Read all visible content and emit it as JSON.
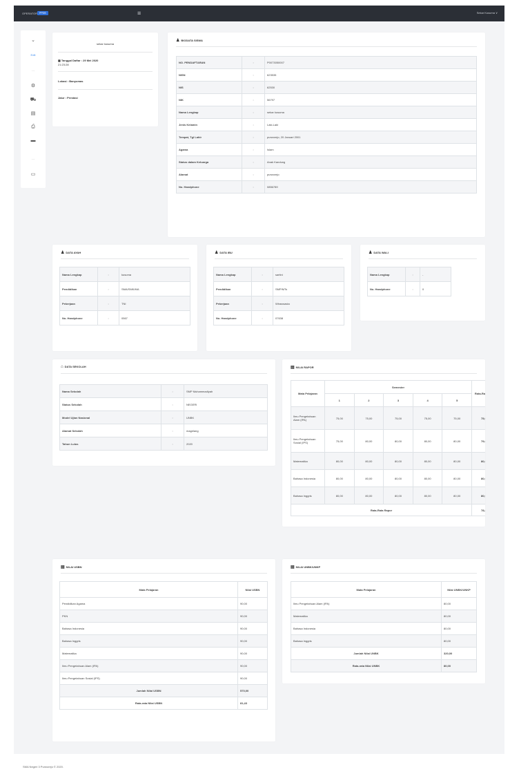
{
  "topbar": {
    "brand": "OPERATOR",
    "brand_badge": "PPDB",
    "user": "Sekar Kusuma"
  },
  "sidebar": {
    "icons": [
      "chevron-down-icon",
      "status-text",
      "divider",
      "settings-icon",
      "truck-icon",
      "file-icon",
      "print-icon",
      "laptop-icon",
      "divider",
      "card-icon"
    ],
    "label_top": "Edit"
  },
  "profile": {
    "name": "sekar kusuma",
    "date_label": "Tanggal Daftar : 29 Mei 2020",
    "date_time": "21:23:28",
    "location": "Lokasi : Banyumas",
    "path": "Jalur : Prestasi"
  },
  "biodata": {
    "title": "BIODATA SISWA",
    "rows": [
      {
        "k": "NO. PENDAFTARAN",
        "v": "P0073050007"
      },
      {
        "k": "NISN",
        "v": "623535"
      },
      {
        "k": "NIS",
        "v": "62530"
      },
      {
        "k": "NIK",
        "v": "56797"
      },
      {
        "k": "Nama Lengkap",
        "v": "sekar kusuma"
      },
      {
        "k": "Jenis Kelamin",
        "v": "Laki-Laki"
      },
      {
        "k": "Tempat, Tgl Lahir",
        "v": "purworejo, 20 Januari 2001"
      },
      {
        "k": "Agama",
        "v": "Islam"
      },
      {
        "k": "Status dalam Keluarga",
        "v": "Anak Kandung"
      },
      {
        "k": "Alamat",
        "v": "purworejo"
      },
      {
        "k": "No. Handphone",
        "v": "0856789"
      }
    ]
  },
  "ayah": {
    "title": "DATA AYAH",
    "rows": [
      {
        "k": "Nama Lengkap",
        "v": "kusuma"
      },
      {
        "k": "Pendidikan",
        "v": "SMA/SMK/MA"
      },
      {
        "k": "Pekerjaan",
        "v": "TNI"
      },
      {
        "k": "No. Handphone",
        "v": "0567"
      }
    ]
  },
  "ibu": {
    "title": "DATA IBU",
    "rows": [
      {
        "k": "Nama Lengkap",
        "v": "sartini"
      },
      {
        "k": "Pendidikan",
        "v": "SMP/MTs"
      },
      {
        "k": "Pekerjaan",
        "v": "Wiraswasta"
      },
      {
        "k": "No. Handphone",
        "v": "07638"
      }
    ]
  },
  "wali": {
    "title": "DATA WALI",
    "rows": [
      {
        "k": "Nama Lengkap",
        "v": "-"
      },
      {
        "k": "No. Handphone",
        "v": "0"
      }
    ]
  },
  "sekolah": {
    "title": "DATA SEKOLAH",
    "rows": [
      {
        "k": "Nama Sekolah",
        "v": "SMP Muhammadiyah"
      },
      {
        "k": "Status Sekolah",
        "v": "NEGERI"
      },
      {
        "k": "Model Ujian Nasional",
        "v": "UNBK"
      },
      {
        "k": "Alamat Sekolah",
        "v": "magelang"
      },
      {
        "k": "Tahun Lulus",
        "v": "2020"
      }
    ]
  },
  "rapor": {
    "title": "NILAI RAPOR",
    "header_subject": "Mata Pelajaran",
    "header_semester": "Semester",
    "header_avg": "Rata-Rata Nilai",
    "semesters": [
      "1",
      "2",
      "3",
      "4",
      "5"
    ],
    "rows": [
      {
        "s": "Ilmu Pengetahuan Alam (IPA)",
        "v": [
          "75,00",
          "75,00",
          "75,00",
          "75,00",
          "75,00"
        ],
        "avg": "75,00"
      },
      {
        "s": "Ilmu Pengetahuan Sosial (IPS)",
        "v": [
          "75,00",
          "80,00",
          "80,00",
          "80,00",
          "80,00"
        ],
        "avg": "79,00"
      },
      {
        "s": "Matematika",
        "v": [
          "80,00",
          "80,00",
          "80,00",
          "80,00",
          "80,00"
        ],
        "avg": "80,00"
      },
      {
        "s": "Bahasa Indonesia",
        "v": [
          "80,00",
          "80,00",
          "80,00",
          "80,00",
          "80,00"
        ],
        "avg": "80,00"
      },
      {
        "s": "Bahasa Inggris",
        "v": [
          "80,00",
          "80,00",
          "80,00",
          "80,00",
          "80,00"
        ],
        "avg": "80,00"
      }
    ],
    "footer_label": "Rata-Rata Rapor",
    "footer_value": "78,80"
  },
  "un": {
    "title": "NILAI USBN",
    "h1": "Mata Pelajaran",
    "h2": "Nilai USBN",
    "rows": [
      {
        "s": "Pendidikan Agama",
        "v": "90,00"
      },
      {
        "s": "PKN",
        "v": "90,00"
      },
      {
        "s": "Bahasa Indonesia",
        "v": "90,00"
      },
      {
        "s": "Bahasa Inggris",
        "v": "90,00"
      },
      {
        "s": "Matematika",
        "v": "90,00"
      },
      {
        "s": "Ilmu Pengetahuan Alam (IPA)",
        "v": "90,00"
      },
      {
        "s": "Ilmu Pengetahuan Sosial (IPS)",
        "v": "90,00"
      }
    ],
    "total_label": "Jumlah Nilai USBN",
    "total_value": "570,00",
    "avg_label": "Rata-rata Nilai USBN",
    "avg_value": "81,43"
  },
  "unbk": {
    "title": "NILAI UNBK/UNKP",
    "h1": "Mata Pelajaran",
    "h2": "Nilai UNBK/UNKP",
    "rows": [
      {
        "s": "Ilmu Pengetahuan Alam (IPA)",
        "v": "80,00"
      },
      {
        "s": "Matematika",
        "v": "80,00"
      },
      {
        "s": "Bahasa Indonesia",
        "v": "80,00"
      },
      {
        "s": "Bahasa Inggris",
        "v": "80,00"
      }
    ],
    "total_label": "Jumlah Nilai UNBK",
    "total_value": "320,00",
    "avg_label": "Rata-rata Nilai UNBK",
    "avg_value": "80,00"
  },
  "footer": "SMA Negeri 3 Purworejo © 2020."
}
